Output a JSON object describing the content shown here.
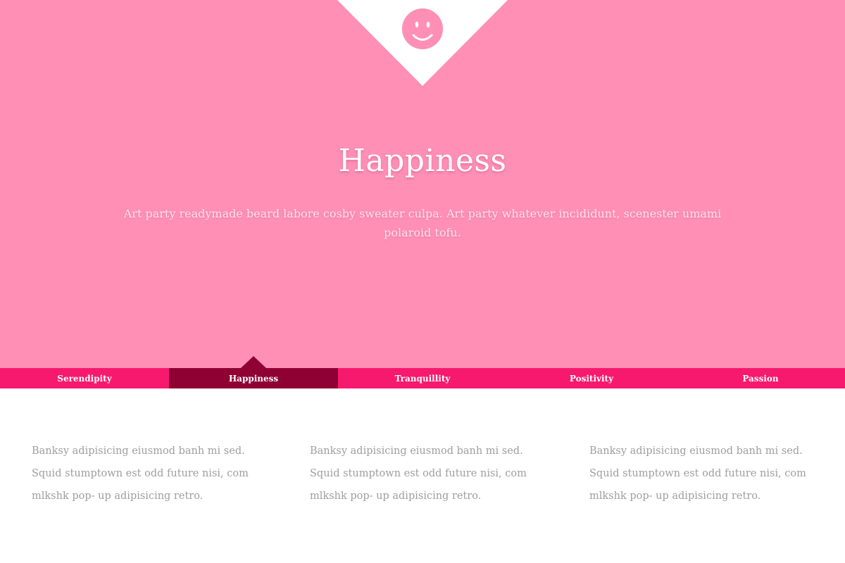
{
  "hero": {
    "title": "Happiness",
    "subtitle": "Art party readymade beard labore cosby sweater culpa. Art party whatever incididunt, scenester umami polaroid tofu.",
    "icon": "smiley-face-icon",
    "background_color": "#ff8fb5"
  },
  "tabs": [
    {
      "label": "Serendipity",
      "active": false
    },
    {
      "label": "Happiness",
      "active": true
    },
    {
      "label": "Tranquillity",
      "active": false
    },
    {
      "label": "Positivity",
      "active": false
    },
    {
      "label": "Passion",
      "active": false
    }
  ],
  "colors": {
    "tab_bar": "#f7196e",
    "tab_active": "#8f0033",
    "body_text": "#9e9e9e"
  },
  "columns": [
    {
      "text": "Banksy adipisicing eiusmod banh mi sed. Squid stumptown est odd future nisi, com mlkshk pop- up adipisicing retro."
    },
    {
      "text": "Banksy adipisicing eiusmod banh mi sed. Squid stumptown est odd future nisi, com mlkshk pop- up adipisicing retro."
    },
    {
      "text": "Banksy adipisicing eiusmod banh mi sed. Squid stumptown est odd future nisi, com mlkshk pop- up adipisicing retro."
    }
  ]
}
